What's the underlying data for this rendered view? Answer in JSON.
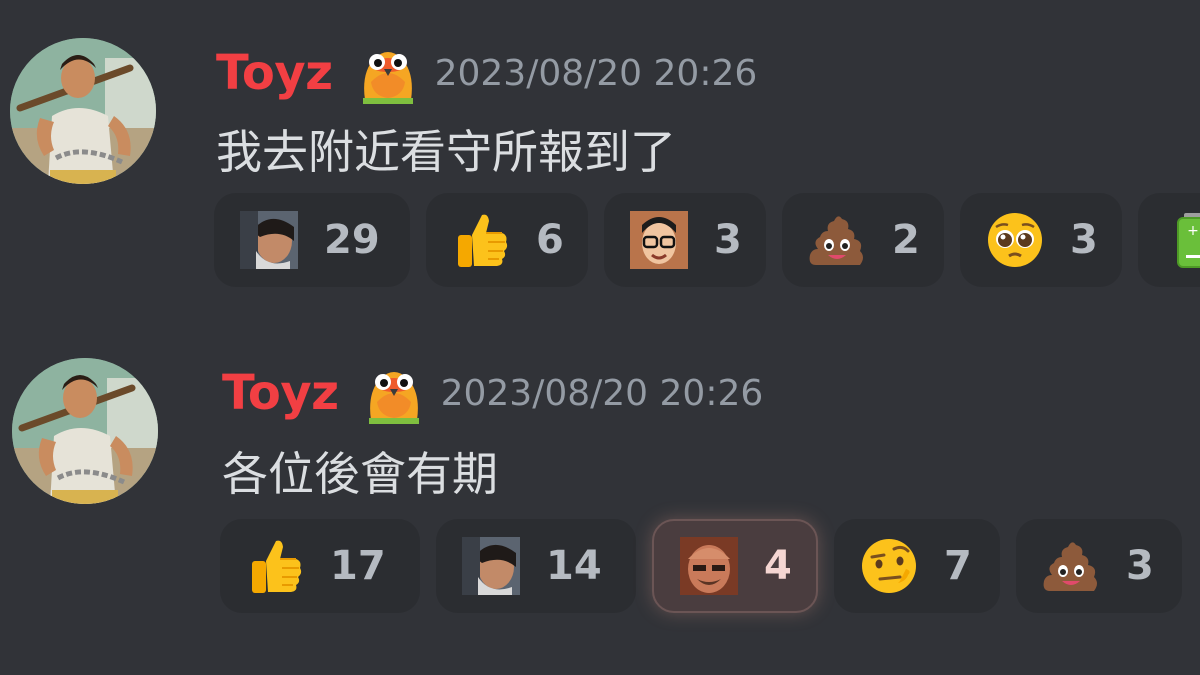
{
  "messages": [
    {
      "username": "Toyz",
      "timestamp": "2023/08/20 20:26",
      "text": "我去附近看守所報到了",
      "reactions": [
        {
          "emoji": "custom-face-emoji",
          "count": "29"
        },
        {
          "emoji": "thumbs-up-emoji",
          "count": "6"
        },
        {
          "emoji": "custom-glasses-face-emoji",
          "count": "3"
        },
        {
          "emoji": "poop-emoji",
          "count": "2"
        },
        {
          "emoji": "pleading-face-emoji",
          "count": "3"
        },
        {
          "emoji": "battery-emoji",
          "count": ""
        }
      ]
    },
    {
      "username": "Toyz",
      "timestamp": "2023/08/20 20:26",
      "text": "各位後會有期",
      "reactions": [
        {
          "emoji": "thumbs-up-emoji",
          "count": "17"
        },
        {
          "emoji": "custom-face-emoji",
          "count": "14"
        },
        {
          "emoji": "custom-bald-face-emoji",
          "count": "4",
          "me": true
        },
        {
          "emoji": "raised-eyebrow-emoji",
          "count": "7"
        },
        {
          "emoji": "poop-emoji",
          "count": "3"
        }
      ]
    }
  ],
  "colors": {
    "background": "#313338",
    "username": "#f23f43",
    "timestamp": "#949ba4",
    "text": "#dbdee1",
    "reaction_bg": "#2b2d31"
  }
}
